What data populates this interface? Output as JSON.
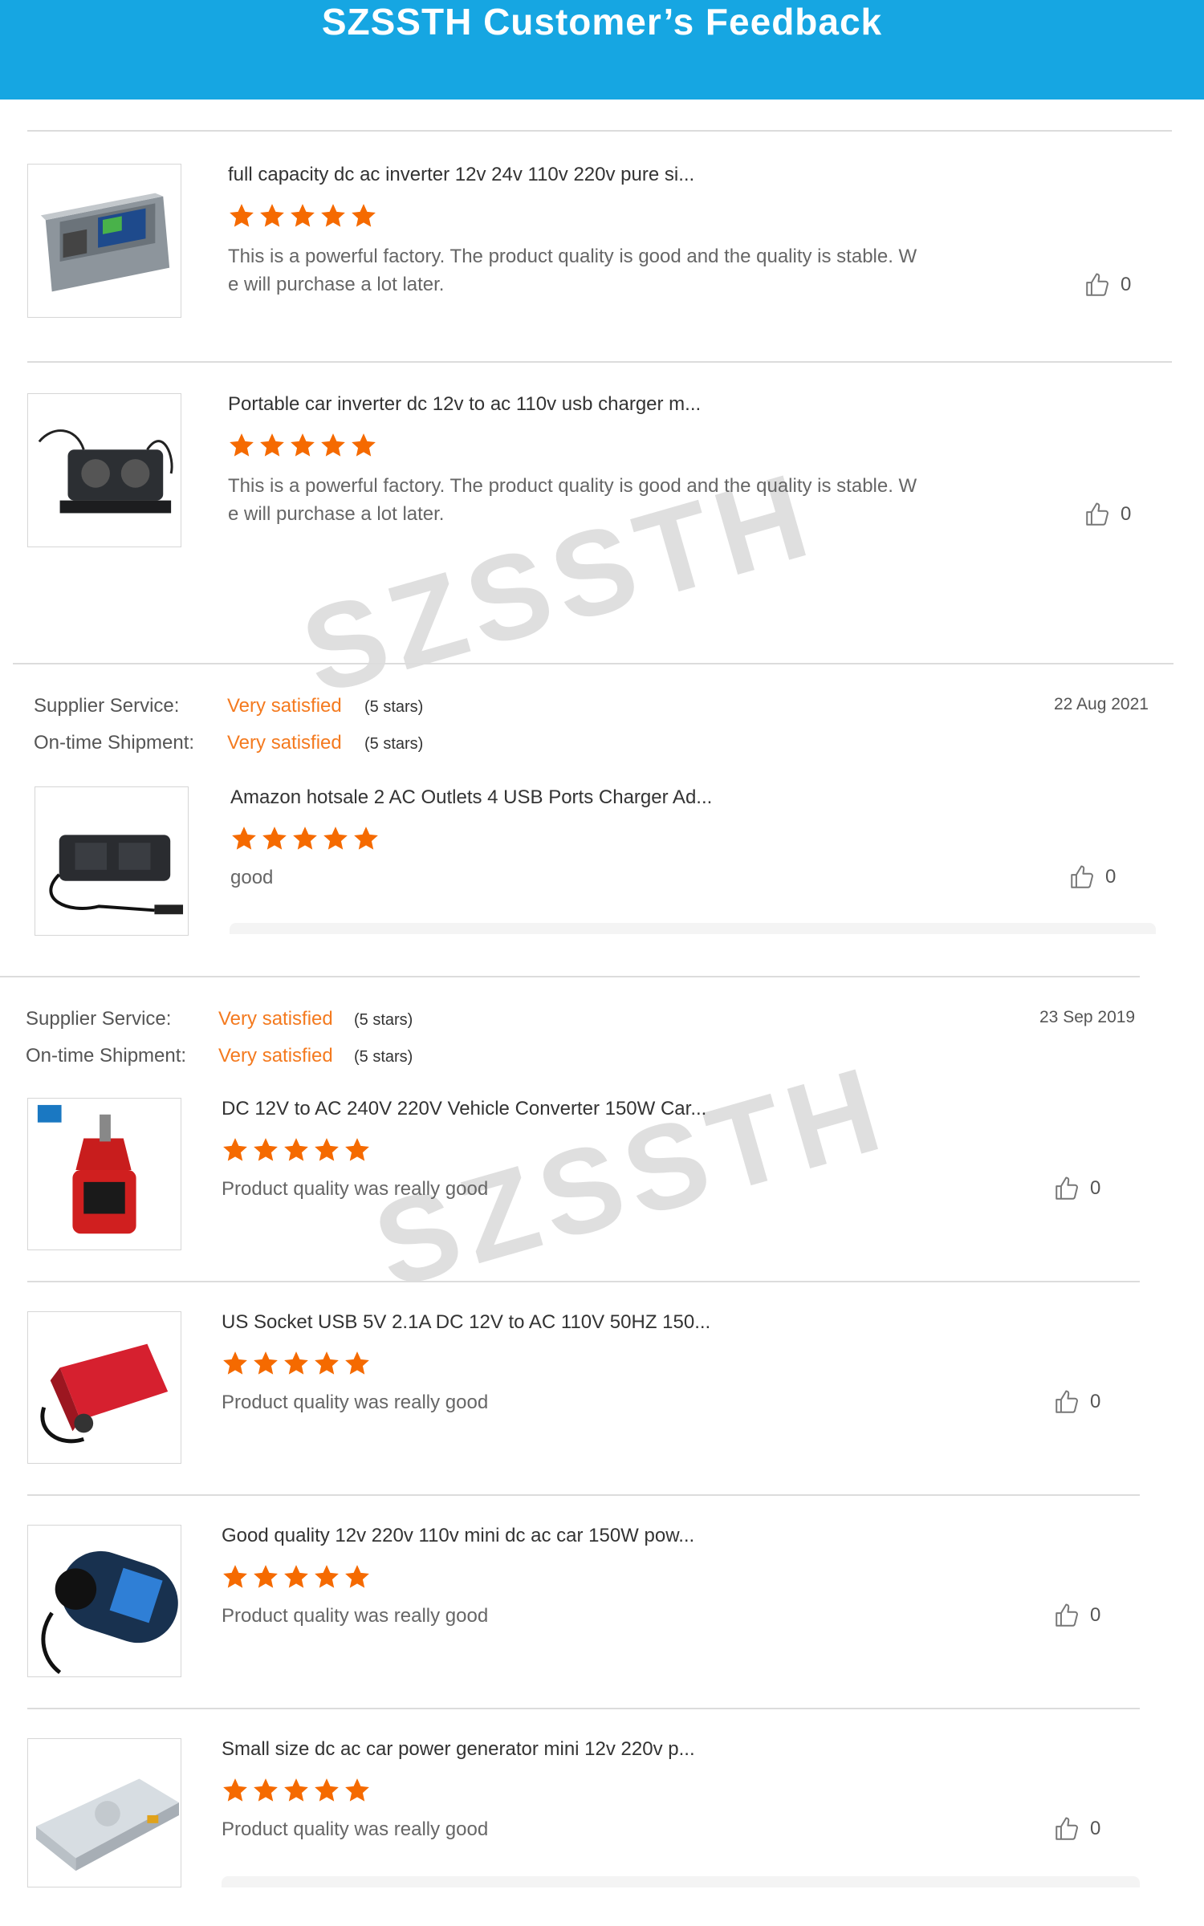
{
  "header": {
    "title": "SZSSTH Customer’s Feedback"
  },
  "watermark": "SZSSTH",
  "reviews_top": [
    {
      "product": "full capacity dc ac inverter 12v 24v 110v 220v pure si...",
      "rating": 5,
      "comment_line1": "This is a powerful factory. The product quality is good and the quality is stable. W",
      "comment_line2": "e will purchase a lot later.",
      "likes": "0"
    },
    {
      "product": "Portable car inverter dc 12v to ac 110v usb charger m...",
      "rating": 5,
      "comment_line1": "This is a powerful factory. The product quality is good and the quality is stable. W",
      "comment_line2": "e will purchase a lot later.",
      "likes": "0"
    }
  ],
  "order1": {
    "supplier_label": "Supplier Service:",
    "supplier_value": "Very satisfied",
    "supplier_count": "(5 stars)",
    "shipment_label": "On-time Shipment:",
    "shipment_value": "Very satisfied",
    "shipment_count": "(5 stars)",
    "date": "22 Aug 2021",
    "review": {
      "product": "Amazon hotsale 2 AC Outlets 4 USB Ports Charger Ad...",
      "rating": 5,
      "comment": "good",
      "likes": "0"
    }
  },
  "order2": {
    "supplier_label": "Supplier Service:",
    "supplier_value": "Very satisfied",
    "supplier_count": "(5 stars)",
    "shipment_label": "On-time Shipment:",
    "shipment_value": "Very satisfied",
    "shipment_count": "(5 stars)",
    "date": "23 Sep 2019",
    "reviews": [
      {
        "product": "DC 12V to AC 240V 220V Vehicle Converter 150W Car...",
        "rating": 5,
        "comment": "Product quality was really good",
        "likes": "0"
      },
      {
        "product": "US Socket USB 5V 2.1A DC 12V to AC 110V 50HZ 150...",
        "rating": 5,
        "comment": "Product quality was really good",
        "likes": "0"
      },
      {
        "product": "Good quality 12v 220v 110v mini dc ac car 150W pow...",
        "rating": 5,
        "comment": "Product quality was really good",
        "likes": "0"
      },
      {
        "product": "Small size dc ac car power generator mini 12v 220v p...",
        "rating": 5,
        "comment": "Product quality was really good",
        "likes": "0"
      }
    ]
  },
  "colors": {
    "header_bg": "#16a6e2",
    "star": "#f56a00",
    "satisfied": "#f47a1f"
  },
  "icons": {
    "star": "star-icon",
    "like": "thumbs-up-icon"
  }
}
